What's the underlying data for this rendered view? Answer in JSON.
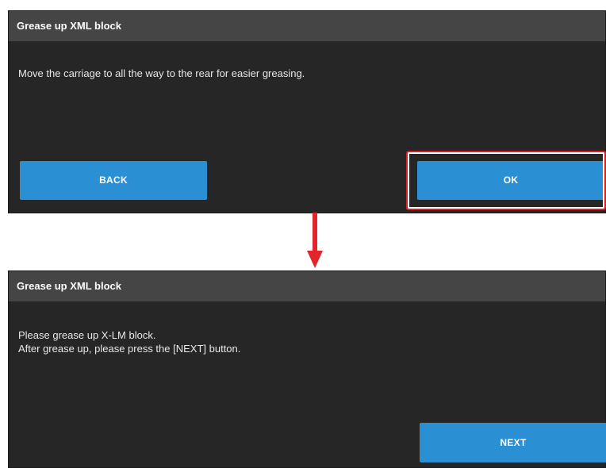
{
  "step1": {
    "title": "Grease up XML block",
    "message": "Move the carriage to all the way to the rear for easier greasing.",
    "back_label": "BACK",
    "ok_label": "OK"
  },
  "step2": {
    "title": "Grease up XML block",
    "message_line1": "Please grease up X-LM block.",
    "message_line2": "After grease up, please press the [NEXT] button.",
    "next_label": "NEXT"
  },
  "colors": {
    "panel_bg": "#262626",
    "titlebar_bg": "#454545",
    "button_bg": "#2a8fd3",
    "highlight": "#d81f26",
    "arrow": "#e1252b"
  }
}
